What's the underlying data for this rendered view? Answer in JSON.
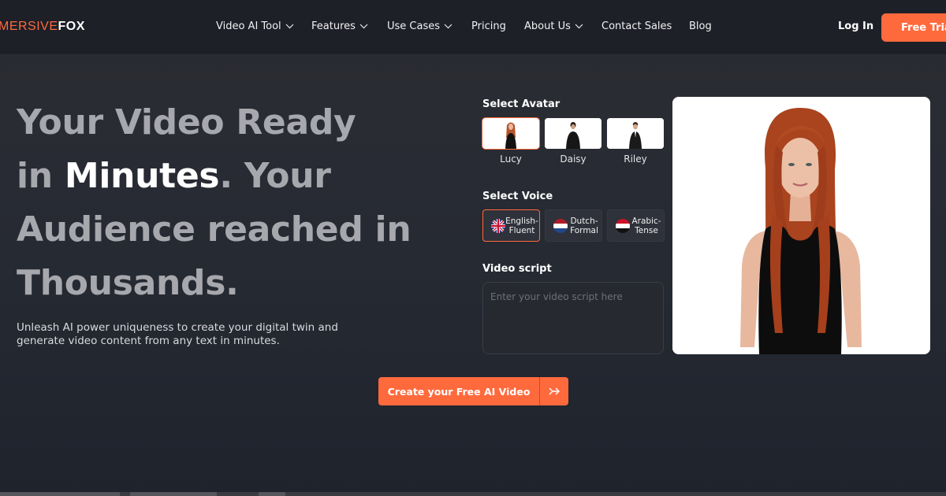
{
  "brand": {
    "logo_part1": "MERSIVE",
    "logo_part2": "FOX",
    "accent": "#ff6a3d"
  },
  "nav": {
    "items": [
      {
        "label": "Video AI Tool",
        "has_dropdown": true
      },
      {
        "label": "Features",
        "has_dropdown": true
      },
      {
        "label": "Use Cases",
        "has_dropdown": true
      },
      {
        "label": "Pricing",
        "has_dropdown": false
      },
      {
        "label": "About Us",
        "has_dropdown": true
      },
      {
        "label": "Contact Sales",
        "has_dropdown": false
      },
      {
        "label": "Blog",
        "has_dropdown": false
      }
    ],
    "login": "Log In",
    "free_trial": "Free Trial"
  },
  "hero": {
    "line1": "Your Video Ready",
    "line2_pre": "in ",
    "line2_highlight": "Minutes",
    "line2_post": ". Your",
    "line3": "Audience reached in",
    "line4": "Thousands.",
    "subtitle": "Unleash AI power uniqueness to create your digital twin and generate video content from any text in minutes."
  },
  "builder": {
    "avatar_label": "Select Avatar",
    "avatars": [
      {
        "name": "Lucy",
        "selected": true
      },
      {
        "name": "Daisy",
        "selected": false
      },
      {
        "name": "Riley",
        "selected": false
      }
    ],
    "voice_label": "Select Voice",
    "voices": [
      {
        "line1": "English-",
        "line2": "Fluent",
        "flag": "uk-flag-icon",
        "selected": true
      },
      {
        "line1": "Dutch-",
        "line2": "Formal",
        "flag": "netherlands-flag-icon",
        "selected": false
      },
      {
        "line1": "Arabic-",
        "line2": "Tense",
        "flag": "arabic-flag-icon",
        "selected": false
      }
    ],
    "script_label": "Video script",
    "script_placeholder": "Enter your video script here",
    "script_value": ""
  },
  "cta": {
    "label": "Create your Free AI Video",
    "icon": "double-arrow-right-icon"
  }
}
